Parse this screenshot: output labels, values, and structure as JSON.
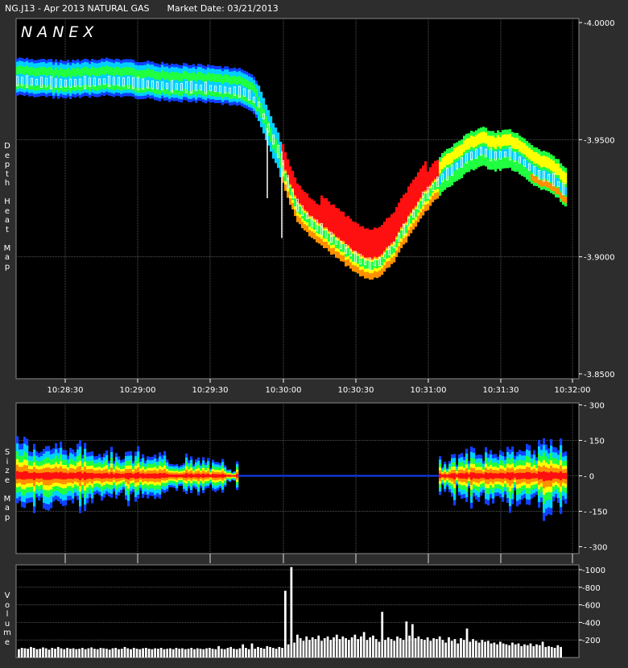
{
  "header": {
    "symbol": "NG.J13 - Apr 2013 NATURAL GAS",
    "market_date": "Market Date: 03/21/2013"
  },
  "logo": "NANEX",
  "panel_labels": {
    "depth": "Depth Heat Map",
    "size": "Size Map",
    "volume": "Volume"
  },
  "colors": {
    "background": "#2d2d2d",
    "plot": "#000000",
    "grid": "#555555",
    "heat_blue": "#1040ff",
    "heat_cyan": "#00d0ff",
    "heat_green": "#20ff40",
    "heat_yellow": "#ffff00",
    "heat_orange": "#ff9000",
    "heat_red": "#ff1010"
  },
  "chart_data": [
    {
      "type": "heatmap",
      "panel": "depth",
      "x_ticks": [
        "10:28:30",
        "10:29:00",
        "10:29:30",
        "10:30:00",
        "10:30:30",
        "10:31:00",
        "10:31:30",
        "10:32:00"
      ],
      "y_ticks": [
        "4.0000",
        "3.9500",
        "3.9000",
        "3.8500"
      ],
      "ylim": [
        3.85,
        4.0
      ],
      "xlim_seconds_from": "10:28:13",
      "price_path": [
        [
          0,
          3.975
        ],
        [
          20,
          3.974
        ],
        [
          40,
          3.975
        ],
        [
          60,
          3.973
        ],
        [
          80,
          3.972
        ],
        [
          95,
          3.97
        ],
        [
          100,
          3.965
        ],
        [
          104,
          3.955
        ],
        [
          108,
          3.945
        ],
        [
          112,
          3.932
        ],
        [
          116,
          3.922
        ],
        [
          122,
          3.915
        ],
        [
          128,
          3.91
        ],
        [
          134,
          3.905
        ],
        [
          140,
          3.9
        ],
        [
          146,
          3.897
        ],
        [
          150,
          3.898
        ],
        [
          156,
          3.905
        ],
        [
          162,
          3.915
        ],
        [
          168,
          3.925
        ],
        [
          174,
          3.932
        ],
        [
          180,
          3.937
        ],
        [
          186,
          3.942
        ],
        [
          192,
          3.945
        ],
        [
          198,
          3.943
        ],
        [
          204,
          3.944
        ],
        [
          210,
          3.94
        ],
        [
          216,
          3.935
        ],
        [
          222,
          3.933
        ],
        [
          227,
          3.928
        ]
      ]
    },
    {
      "type": "heatmap",
      "panel": "size",
      "y_ticks": [
        "300",
        "150",
        "0",
        "-150",
        "-300"
      ],
      "ylim": [
        -300,
        300
      ]
    },
    {
      "type": "bar",
      "panel": "volume",
      "y_ticks": [
        "1000",
        "800",
        "600",
        "400",
        "200"
      ],
      "ylim": [
        0,
        1050
      ],
      "values": [
        95,
        110,
        105,
        100,
        120,
        110,
        95,
        100,
        115,
        105,
        90,
        110,
        100,
        120,
        105,
        95,
        110,
        100,
        105,
        95,
        100,
        110,
        95,
        105,
        115,
        100,
        95,
        110,
        105,
        100,
        90,
        105,
        110,
        95,
        100,
        120,
        105,
        95,
        110,
        100,
        95,
        105,
        110,
        100,
        95,
        105,
        100,
        110,
        95,
        100,
        105,
        95,
        110,
        100,
        105,
        95,
        100,
        110,
        95,
        105,
        100,
        95,
        105,
        110,
        100,
        95,
        130,
        100,
        95,
        110,
        120,
        100,
        95,
        105,
        150,
        110,
        95,
        160,
        100,
        120,
        110,
        100,
        130,
        120,
        110,
        100,
        120,
        110,
        760,
        150,
        1030,
        170,
        260,
        220,
        190,
        240,
        200,
        230,
        210,
        250,
        190,
        220,
        240,
        200,
        230,
        260,
        210,
        240,
        220,
        200,
        230,
        260,
        210,
        240,
        290,
        200,
        230,
        250,
        210,
        180,
        520,
        200,
        230,
        210,
        190,
        240,
        220,
        200,
        410,
        250,
        380,
        220,
        240,
        210,
        200,
        230,
        190,
        220,
        210,
        240,
        200,
        170,
        230,
        190,
        210,
        160,
        220,
        200,
        330,
        180,
        210,
        190,
        170,
        200,
        180,
        190,
        160,
        170,
        150,
        180,
        160,
        150,
        140,
        170,
        150,
        160,
        130,
        150,
        140,
        160,
        130,
        150,
        140,
        180,
        120,
        130,
        120,
        110,
        140,
        120
      ]
    }
  ]
}
